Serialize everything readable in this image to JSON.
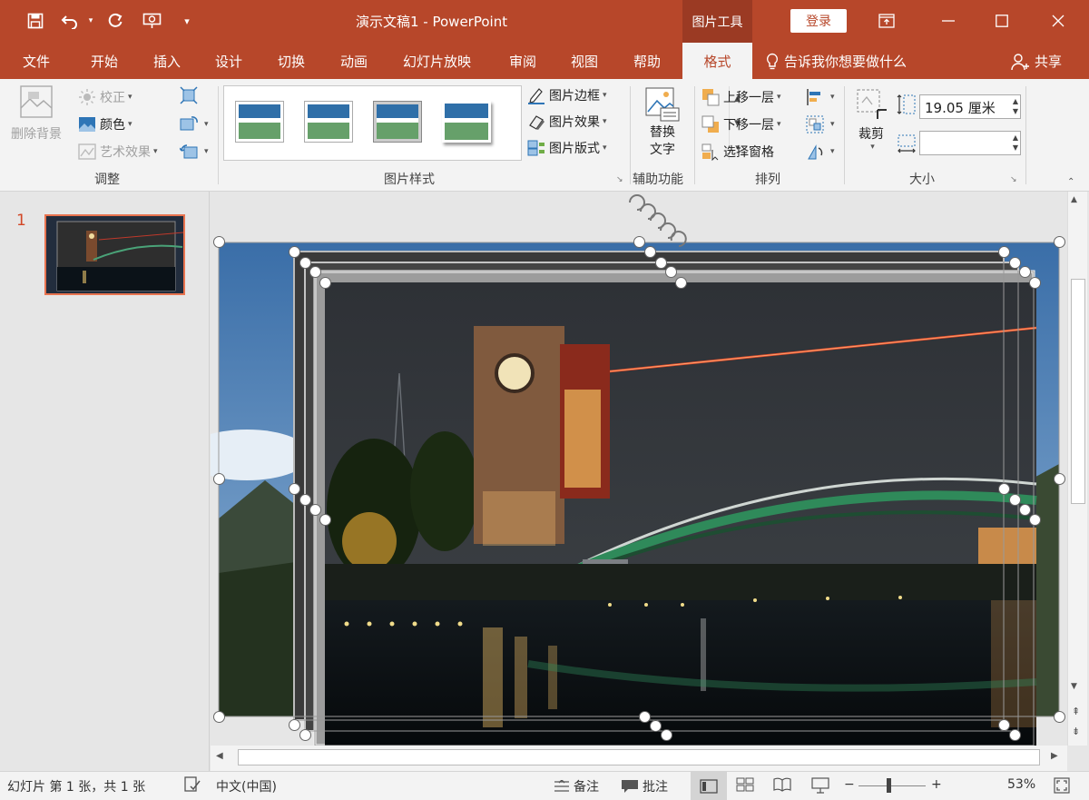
{
  "app": {
    "window_title": "演示文稿1  -  PowerPoint",
    "contextual_tab_group": "图片工具",
    "login_label": "登录",
    "accent_color": "#b7472a"
  },
  "quick_access": {
    "icons": [
      "save-icon",
      "undo-icon",
      "redo-icon",
      "present-from-start-icon",
      "customize-qat-icon"
    ]
  },
  "tabs": [
    {
      "label": "文件"
    },
    {
      "label": "开始"
    },
    {
      "label": "插入"
    },
    {
      "label": "设计"
    },
    {
      "label": "切换"
    },
    {
      "label": "动画"
    },
    {
      "label": "幻灯片放映"
    },
    {
      "label": "审阅"
    },
    {
      "label": "视图"
    },
    {
      "label": "帮助"
    },
    {
      "label": "格式",
      "active": true
    }
  ],
  "tell_me": "告诉我你想要做什么",
  "share": "共享",
  "ribbon": {
    "adjust": {
      "group_label": "调整",
      "remove_bg": "删除背景",
      "correct": "校正",
      "color": "颜色",
      "artistic": "艺术效果"
    },
    "styles": {
      "group_label": "图片样式",
      "border": "图片边框",
      "effects": "图片效果",
      "layout": "图片版式"
    },
    "accessibility": {
      "group_label": "辅助功能",
      "alt_text_line1": "替换",
      "alt_text_line2": "文字"
    },
    "arrange": {
      "group_label": "排列",
      "bring_forward": "上移一层",
      "send_backward": "下移一层",
      "selection_pane": "选择窗格"
    },
    "size": {
      "group_label": "大小",
      "crop": "裁剪",
      "height_value": "19.05 厘米",
      "width_value": ""
    }
  },
  "slides_panel": {
    "slide_number": "1"
  },
  "status": {
    "slide_info": "幻灯片 第 1 张，共 1 张",
    "language": "中文(中国)",
    "notes": "备注",
    "comments": "批注",
    "zoom": "53%",
    "zoom_level": 0.53
  }
}
